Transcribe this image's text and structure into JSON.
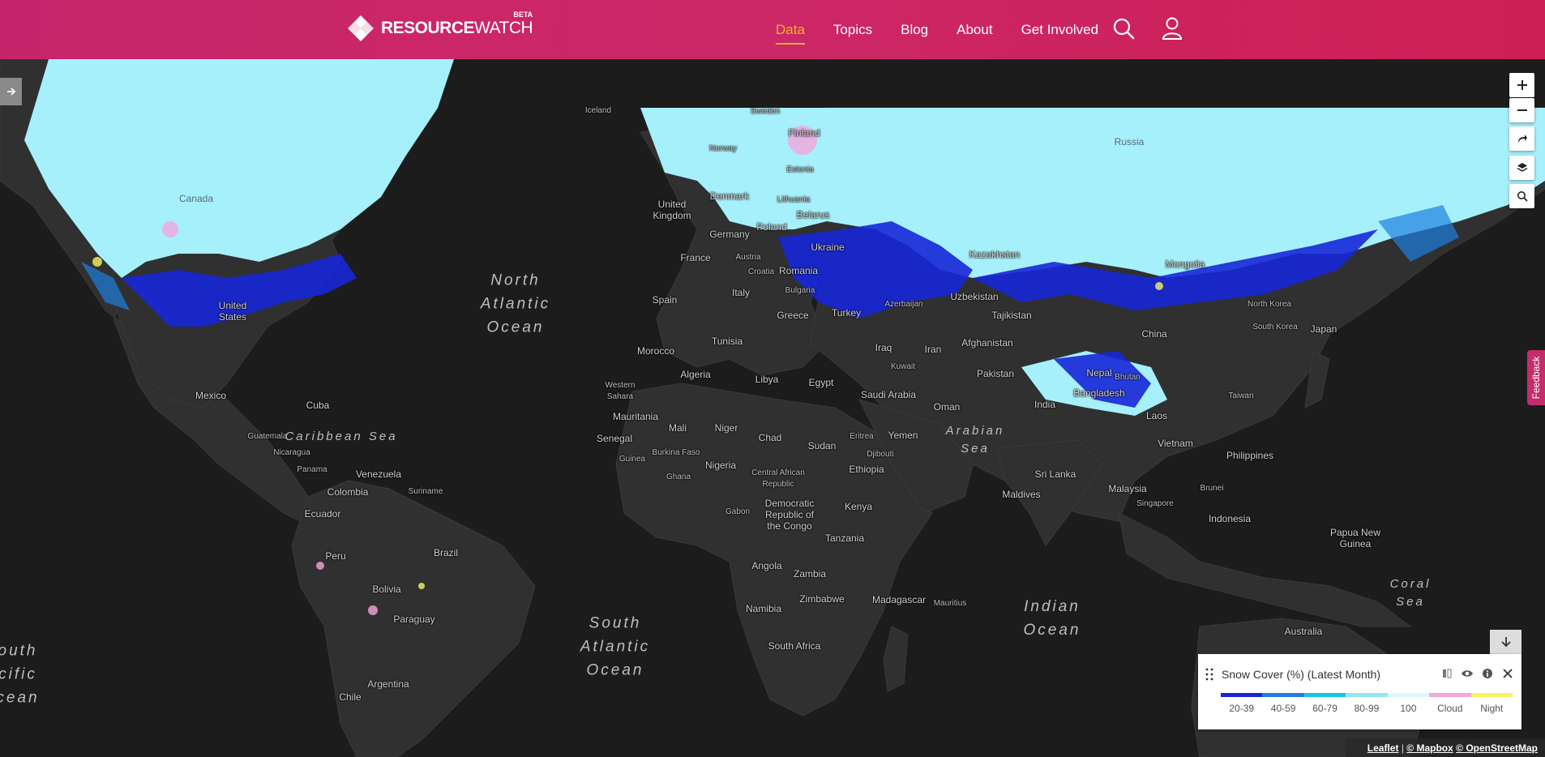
{
  "header": {
    "logo_bold": "RESOURCE",
    "logo_light": "WATCH",
    "beta": "BETA",
    "nav": [
      "Data",
      "Topics",
      "Blog",
      "About",
      "Get Involved"
    ],
    "active": "Data"
  },
  "map": {
    "countries": [
      [
        "Iceland",
        738,
        137,
        "sm"
      ],
      [
        "Sweden",
        944,
        138,
        "sm"
      ],
      [
        "Finland",
        992,
        164,
        ""
      ],
      [
        "Norway",
        892,
        184,
        "sm"
      ],
      [
        "Russia",
        1393,
        175,
        "snow"
      ],
      [
        "Canada",
        242,
        245,
        "snow"
      ],
      [
        "United\nKingdom",
        829,
        259,
        ""
      ],
      [
        "Denmark",
        900,
        242,
        ""
      ],
      [
        "Estonia",
        987,
        210,
        "sm"
      ],
      [
        "Lithuania",
        979,
        247,
        "sm"
      ],
      [
        "Belarus",
        1003,
        265,
        ""
      ],
      [
        "Poland",
        952,
        280,
        ""
      ],
      [
        "Germany",
        900,
        289,
        ""
      ],
      [
        "Ukraine",
        1021,
        305,
        ""
      ],
      [
        "Kazakhstan",
        1227,
        314,
        ""
      ],
      [
        "Mongolia",
        1462,
        326,
        ""
      ],
      [
        "France",
        858,
        318,
        ""
      ],
      [
        "Austria",
        923,
        318,
        "sm"
      ],
      [
        "Croatia",
        939,
        336,
        "sm"
      ],
      [
        "Romania",
        985,
        334,
        ""
      ],
      [
        "Bulgaria",
        987,
        359,
        "sm"
      ],
      [
        "Uzbekistan",
        1202,
        366,
        ""
      ],
      [
        "United\nStates",
        287,
        384,
        ""
      ],
      [
        "Spain",
        820,
        370,
        ""
      ],
      [
        "Italy",
        914,
        361,
        ""
      ],
      [
        "Greece",
        978,
        389,
        ""
      ],
      [
        "Turkey",
        1044,
        386,
        ""
      ],
      [
        "Azerbaijan",
        1115,
        376,
        "sm"
      ],
      [
        "Tajikistan",
        1248,
        389,
        ""
      ],
      [
        "North Korea",
        1566,
        376,
        "sm"
      ],
      [
        "South Korea",
        1573,
        404,
        "sm"
      ],
      [
        "Japan",
        1633,
        406,
        ""
      ],
      [
        "Afghanistan",
        1218,
        423,
        ""
      ],
      [
        "China",
        1424,
        412,
        ""
      ],
      [
        "Tunisia",
        897,
        421,
        ""
      ],
      [
        "Iraq",
        1090,
        429,
        ""
      ],
      [
        "Iran",
        1151,
        431,
        ""
      ],
      [
        "Nepal",
        1356,
        460,
        ""
      ],
      [
        "Morocco",
        809,
        433,
        ""
      ],
      [
        "Kuwait",
        1114,
        453,
        "sm"
      ],
      [
        "Pakistan",
        1228,
        461,
        ""
      ],
      [
        "Bhutan",
        1391,
        466,
        "sm"
      ],
      [
        "Algeria",
        858,
        462,
        ""
      ],
      [
        "Libya",
        946,
        468,
        ""
      ],
      [
        "Egypt",
        1013,
        472,
        ""
      ],
      [
        "Mexico",
        260,
        488,
        ""
      ],
      [
        "Western\nSahara",
        765,
        483,
        "sm"
      ],
      [
        "Saudi Arabia",
        1096,
        487,
        ""
      ],
      [
        "Bangladesh",
        1356,
        485,
        ""
      ],
      [
        "Taiwan",
        1531,
        489,
        "sm"
      ],
      [
        "Oman",
        1168,
        502,
        ""
      ],
      [
        "Cuba",
        392,
        500,
        ""
      ],
      [
        "India",
        1289,
        499,
        ""
      ],
      [
        "Laos",
        1427,
        513,
        ""
      ],
      [
        "Mauritania",
        784,
        514,
        ""
      ],
      [
        "Mali",
        836,
        528,
        ""
      ],
      [
        "Niger",
        896,
        528,
        ""
      ],
      [
        "Eritrea",
        1063,
        539,
        "sm"
      ],
      [
        "Yemen",
        1114,
        537,
        ""
      ],
      [
        "Guatemala",
        330,
        539,
        "sm"
      ],
      [
        "Chad",
        950,
        540,
        ""
      ],
      [
        "Senegal",
        758,
        541,
        ""
      ],
      [
        "Sudan",
        1014,
        550,
        ""
      ],
      [
        "Vietnam",
        1450,
        547,
        ""
      ],
      [
        "Nicaragua",
        360,
        559,
        "sm"
      ],
      [
        "Burkina Faso",
        834,
        559,
        "sm"
      ],
      [
        "Djibouti",
        1086,
        561,
        "sm"
      ],
      [
        "Philippines",
        1542,
        562,
        ""
      ],
      [
        "Guinea",
        780,
        567,
        "sm"
      ],
      [
        "Nigeria",
        889,
        574,
        ""
      ],
      [
        "Panama",
        385,
        580,
        "sm"
      ],
      [
        "Venezuela",
        467,
        585,
        ""
      ],
      [
        "Ethiopia",
        1069,
        579,
        ""
      ],
      [
        "Sri Lanka",
        1302,
        585,
        ""
      ],
      [
        "Central African\nRepublic",
        960,
        591,
        "sm"
      ],
      [
        "Ghana",
        837,
        589,
        "sm"
      ],
      [
        "Malaysia",
        1391,
        603,
        ""
      ],
      [
        "Brunei",
        1495,
        603,
        "sm"
      ],
      [
        "Colombia",
        429,
        607,
        ""
      ],
      [
        "Suriname",
        525,
        607,
        "sm"
      ],
      [
        "Maldives",
        1260,
        610,
        ""
      ],
      [
        "Singapore",
        1425,
        622,
        "sm"
      ],
      [
        "Democratic\nRepublic of\nthe Congo",
        974,
        635,
        ""
      ],
      [
        "Ecuador",
        398,
        634,
        ""
      ],
      [
        "Gabon",
        910,
        632,
        "sm"
      ],
      [
        "Kenya",
        1059,
        625,
        ""
      ],
      [
        "Indonesia",
        1517,
        640,
        ""
      ],
      [
        "Papua New\nGuinea",
        1672,
        664,
        ""
      ],
      [
        "Peru",
        414,
        686,
        ""
      ],
      [
        "Brazil",
        550,
        682,
        ""
      ],
      [
        "Tanzania",
        1042,
        664,
        ""
      ],
      [
        "Angola",
        946,
        698,
        ""
      ],
      [
        "Zambia",
        999,
        708,
        ""
      ],
      [
        "Bolivia",
        477,
        727,
        ""
      ],
      [
        "Zimbabwe",
        1014,
        739,
        ""
      ],
      [
        "Madagascar",
        1109,
        740,
        ""
      ],
      [
        "Mauritius",
        1172,
        745,
        "sm"
      ],
      [
        "Namibia",
        942,
        751,
        ""
      ],
      [
        "Paraguay",
        511,
        764,
        ""
      ],
      [
        "Australia",
        1608,
        779,
        ""
      ],
      [
        "South Africa",
        980,
        797,
        ""
      ],
      [
        "Argentina",
        479,
        844,
        ""
      ],
      [
        "Chile",
        432,
        860,
        ""
      ]
    ],
    "oceans": [
      [
        "North\nAtlantic\nOcean",
        636,
        375,
        ""
      ],
      [
        "Caribbean Sea",
        421,
        539,
        "s"
      ],
      [
        "Arabian\nSea",
        1203,
        543,
        "s"
      ],
      [
        "South\nAtlantic\nOcean",
        759,
        798,
        ""
      ],
      [
        "Indian\nOcean",
        1298,
        763,
        ""
      ],
      [
        "Coral\nSea",
        1740,
        732,
        "s"
      ],
      [
        "outh\ncific\ncean",
        22,
        832,
        ""
      ]
    ]
  },
  "legend": {
    "title": "Snow Cover (%) (Latest Month)",
    "items": [
      {
        "label": "20-39",
        "color": "#1a26d4"
      },
      {
        "label": "40-59",
        "color": "#1e7fe0"
      },
      {
        "label": "60-79",
        "color": "#18c3e6"
      },
      {
        "label": "80-99",
        "color": "#93e8f3"
      },
      {
        "label": "100",
        "color": "#dff8fb"
      },
      {
        "label": "Cloud",
        "color": "#f4a6dc"
      },
      {
        "label": "Night",
        "color": "#f6f262"
      }
    ]
  },
  "attribution": {
    "leaflet": "Leaflet",
    "mapbox": "© Mapbox",
    "osm": "© OpenStreetMap"
  },
  "feedback": "Feedback"
}
